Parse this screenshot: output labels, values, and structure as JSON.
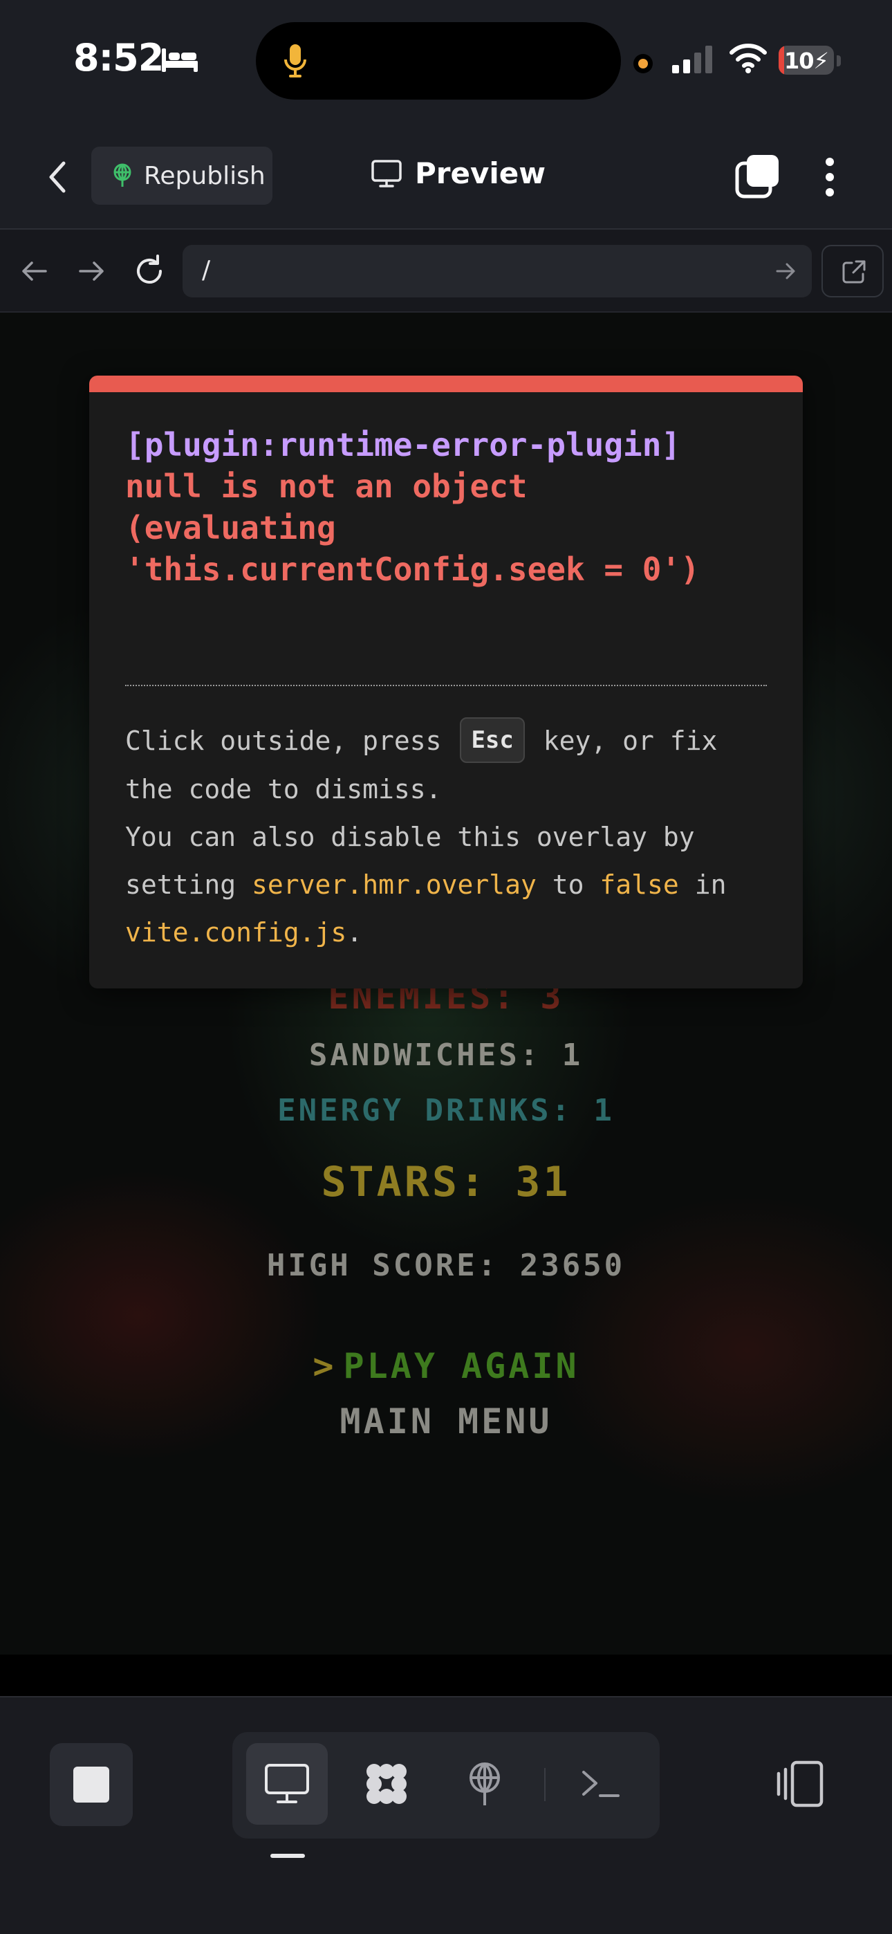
{
  "status_bar": {
    "time": "8:52",
    "battery_text": "10",
    "battery_level": 0.1,
    "bed_icon": "bed-icon",
    "mic_icon": "microphone-icon",
    "signal_icon": "cellular-signal-icon",
    "wifi_icon": "wifi-icon"
  },
  "header": {
    "republish_label": "Republish",
    "title": "Preview"
  },
  "browser": {
    "url": "/"
  },
  "game": {
    "enemies": "ENEMIES: 3",
    "sandwiches": "SANDWICHES: 1",
    "energy_drinks": "ENERGY DRINKS: 1",
    "stars": "STARS: 31",
    "high_score": "HIGH SCORE: 23650",
    "play_caret": ">",
    "play_again": "PLAY AGAIN",
    "main_menu": "MAIN MENU"
  },
  "error_overlay": {
    "plugin": "[plugin:runtime-error-plugin]",
    "message": "null is not an object\n(evaluating\n'this.currentConfig.seek = 0')",
    "tip_part1": "Click outside, press",
    "tip_key": "Esc",
    "tip_part2": "key, or fix the code to dismiss.",
    "tip_part3": "You can also disable this overlay by setting",
    "tip_code1": "server.hmr.overlay",
    "tip_part4": "to",
    "tip_code2": "false",
    "tip_part5": "in",
    "tip_code3": "vite.config.js",
    "tip_part6": "."
  },
  "colors": {
    "error_accent": "#e85b50",
    "plugin_purple": "#c79cff",
    "code_yellow": "#f0b44a",
    "battery_red": "#e5453b"
  }
}
